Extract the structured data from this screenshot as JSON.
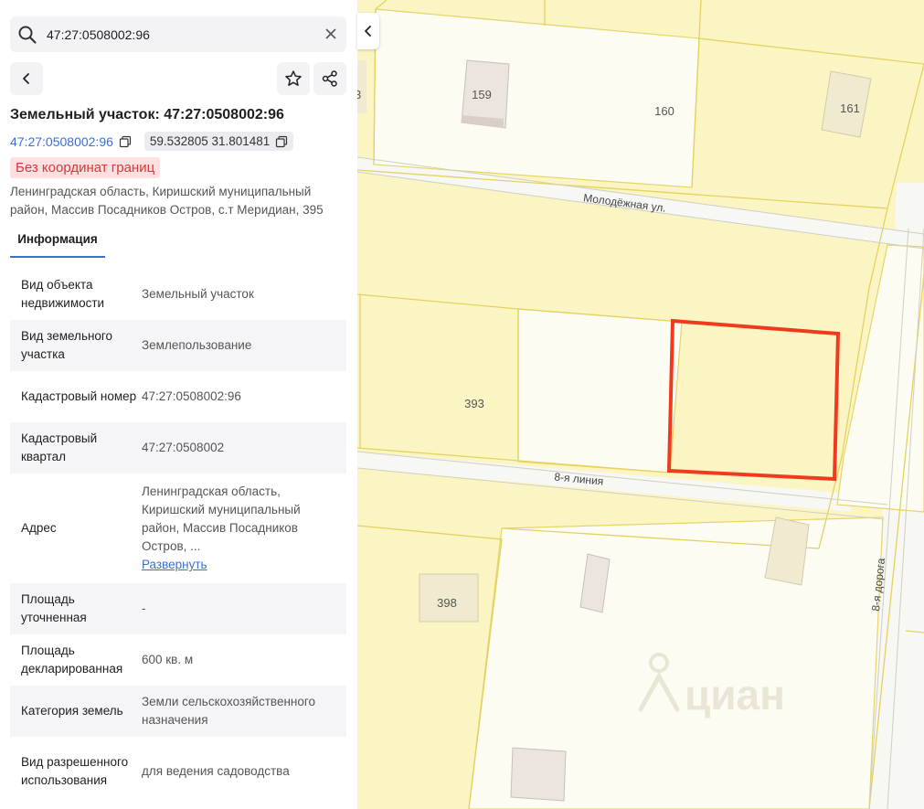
{
  "search": {
    "value": "47:27:0508002:96",
    "placeholder": ""
  },
  "object": {
    "title": "Земельный участок: 47:27:0508002:96",
    "cad_link": "47:27:0508002:96",
    "coords": "59.532805 31.801481",
    "badge": "Без координат границ",
    "address": "Ленинградская область, Киришский муниципальный район, Массив Посадников Остров, с.т Меридиан, 395"
  },
  "tabs": [
    {
      "label": "Информация"
    }
  ],
  "info_rows": [
    {
      "key": "Вид объекта недвижимости",
      "value": "Земельный участок"
    },
    {
      "key": "Вид земельного участка",
      "value": "Землепользование"
    },
    {
      "key": "Кадастровый номер",
      "value": "47:27:0508002:96"
    },
    {
      "key": "Кадастровый квартал",
      "value": "47:27:0508002"
    },
    {
      "key": "Адрес",
      "value": "Ленинградская область, Киришский муниципальный район, Массив Посадников Остров, ...",
      "link": "Развернуть"
    },
    {
      "key": "Площадь уточненная",
      "value": "-"
    },
    {
      "key": "Площадь декларированная",
      "value": "600 кв. м"
    },
    {
      "key": "Категория земель",
      "value": "Земли сельскохозяйственного назначения"
    },
    {
      "key": "Вид разрешенного использования",
      "value": "для ведения садоводства"
    }
  ],
  "map": {
    "plots": [
      "159",
      "160",
      "161",
      "393",
      "398",
      "3"
    ],
    "streets": [
      "Молодёжная ул.",
      "8-я линия",
      "8-я дорога"
    ],
    "watermark": "циан",
    "highlight_color": "#f03a1e"
  }
}
